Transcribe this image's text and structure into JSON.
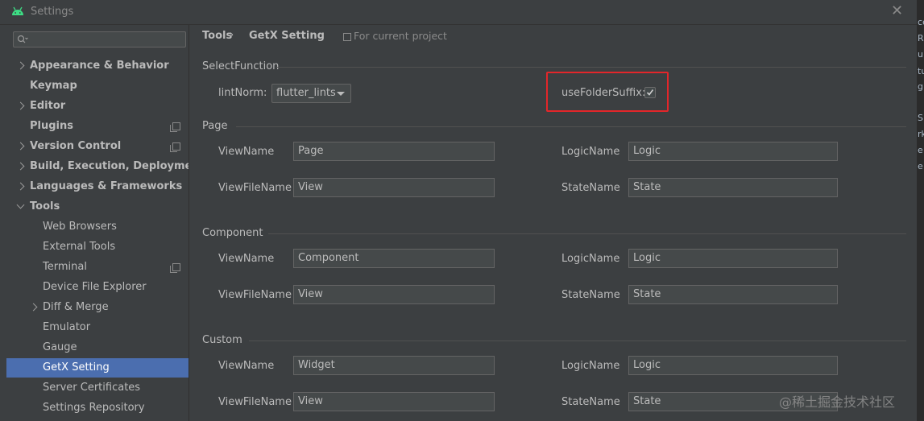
{
  "window": {
    "title": "Settings",
    "close_glyph": "✕"
  },
  "right_strip": [
    "ce",
    "R",
    "u",
    "tu",
    "g",
    "S",
    "rk",
    "e",
    "e"
  ],
  "sidebar": {
    "search": {
      "placeholder": ""
    },
    "items": [
      {
        "label": "Appearance & Behavior",
        "arrow": "right"
      },
      {
        "label": "Keymap"
      },
      {
        "label": "Editor",
        "arrow": "right"
      },
      {
        "label": "Plugins",
        "copy": true
      },
      {
        "label": "Version Control",
        "arrow": "right",
        "copy": true
      },
      {
        "label": "Build, Execution, Deployment",
        "arrow": "right"
      },
      {
        "label": "Languages & Frameworks",
        "arrow": "right"
      },
      {
        "label": "Tools",
        "arrow": "down"
      },
      {
        "label": "Web Browsers"
      },
      {
        "label": "External Tools"
      },
      {
        "label": "Terminal",
        "copy": true
      },
      {
        "label": "Device File Explorer"
      },
      {
        "label": "Diff & Merge",
        "arrow": "right"
      },
      {
        "label": "Emulator"
      },
      {
        "label": "Gauge"
      },
      {
        "label": "GetX Setting",
        "selected": true
      },
      {
        "label": "Server Certificates"
      },
      {
        "label": "Settings Repository"
      }
    ]
  },
  "breadcrumb": {
    "parent": "Tools",
    "separator": "›",
    "current": "GetX Setting",
    "scope": "For current project"
  },
  "select_function": {
    "title": "SelectFunction",
    "lint_norm_label": "lintNorm:",
    "lint_norm_value": "flutter_lints",
    "use_folder_suffix_label": "useFolderSuffix:",
    "use_folder_suffix_checked": true
  },
  "sections": [
    {
      "title": "Page",
      "view_name_label": "ViewName",
      "view_name": "Page",
      "logic_name_label": "LogicName",
      "logic_name": "Logic",
      "view_file_name_label": "ViewFileName",
      "view_file_name": "View",
      "state_name_label": "StateName",
      "state_name": "State"
    },
    {
      "title": "Component",
      "view_name_label": "ViewName",
      "view_name": "Component",
      "logic_name_label": "LogicName",
      "logic_name": "Logic",
      "view_file_name_label": "ViewFileName",
      "view_file_name": "View",
      "state_name_label": "StateName",
      "state_name": "State"
    },
    {
      "title": "Custom",
      "view_name_label": "ViewName",
      "view_name": "Widget",
      "logic_name_label": "LogicName",
      "logic_name": "Logic",
      "view_file_name_label": "ViewFileName",
      "view_file_name": "View",
      "state_name_label": "StateName",
      "state_name": "State"
    }
  ],
  "watermark": "@稀土掘金技术社区"
}
